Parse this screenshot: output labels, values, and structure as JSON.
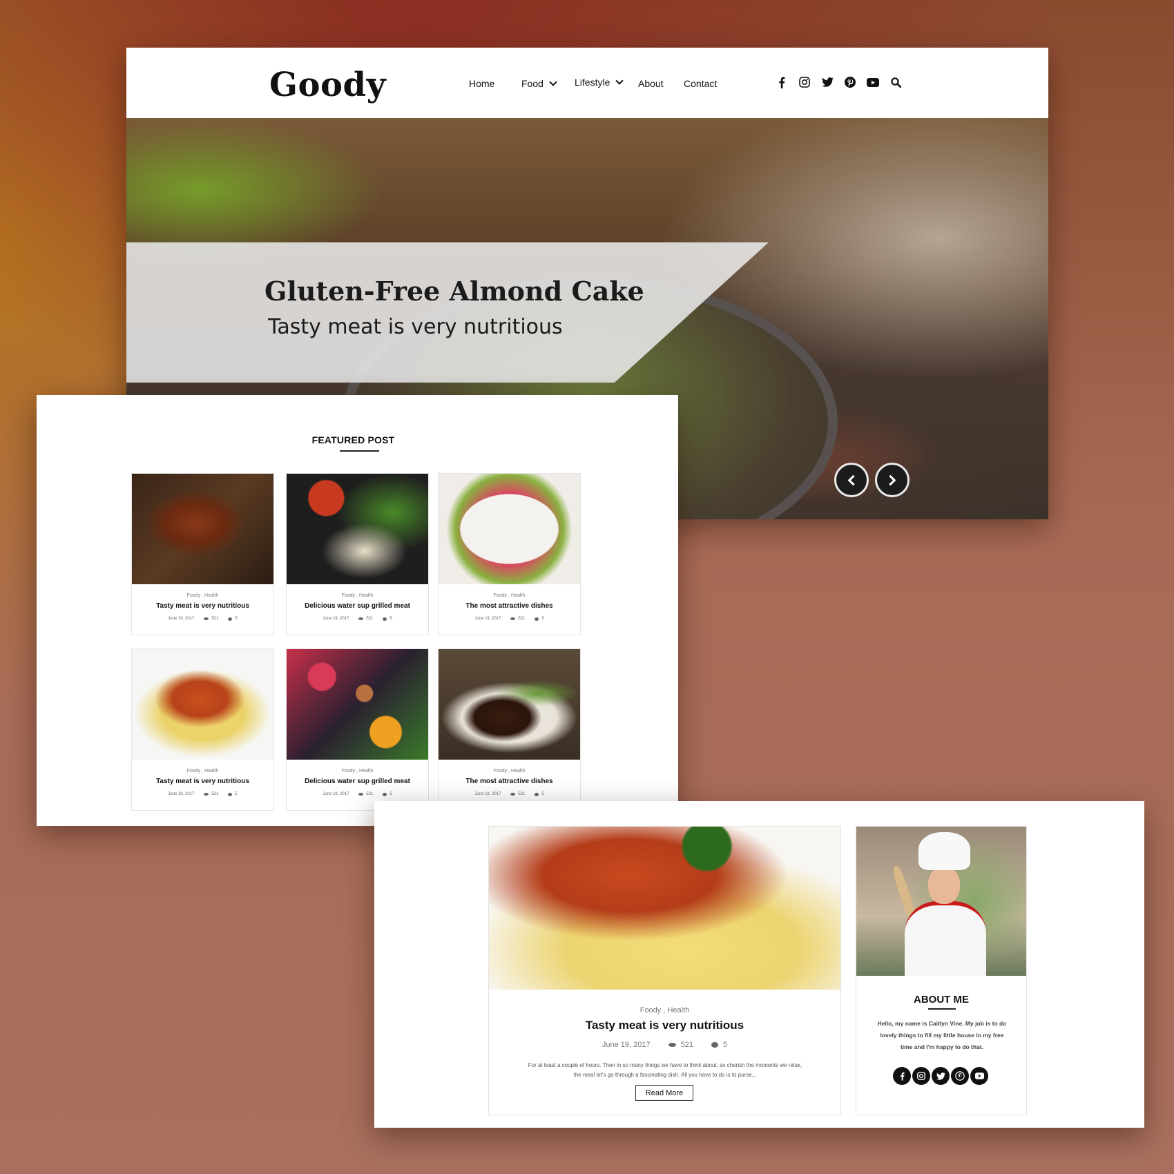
{
  "site": {
    "logo": "Goody",
    "nav": [
      {
        "label": "Home",
        "has_dropdown": false
      },
      {
        "label": "Food",
        "has_dropdown": true
      },
      {
        "label": "Lifestyle",
        "has_dropdown": true
      },
      {
        "label": "About",
        "has_dropdown": false
      },
      {
        "label": "Contact",
        "has_dropdown": false
      }
    ],
    "social_icons": [
      "facebook-icon",
      "instagram-icon",
      "twitter-icon",
      "pinterest-icon",
      "youtube-icon",
      "search-icon"
    ]
  },
  "hero": {
    "title": "Gluten-Free Almond Cake",
    "subtitle": "Tasty meat is very nutritious",
    "prev_icon": "chevron-left-icon",
    "next_icon": "chevron-right-icon"
  },
  "featured": {
    "heading": "FEATURED POST",
    "cards": [
      {
        "image": "grilled-steak-on-board",
        "categories": "Foody , Health",
        "title": "Tasty meat is very nutritious",
        "date": "June 19, 2017",
        "views": "521",
        "comments": "5"
      },
      {
        "image": "vegetables-tomato-broccoli",
        "categories": "Foody , Health",
        "title": "Delicious water sup grilled meat",
        "date": "June 19, 2017",
        "views": "521",
        "comments": "5"
      },
      {
        "image": "fruit-platter",
        "categories": "Foody , Health",
        "title": "The most attractive dishes",
        "date": "June 19, 2017",
        "views": "521",
        "comments": "5"
      },
      {
        "image": "spaghetti-bolognese",
        "categories": "Foody , Health",
        "title": "Tasty meat is very nutritious",
        "date": "June 19, 2017",
        "views": "521",
        "comments": "5"
      },
      {
        "image": "berries-nuts-mango",
        "categories": "Foody , Health",
        "title": "Delicious water sup grilled meat",
        "date": "June 19, 2017",
        "views": "521",
        "comments": "5"
      },
      {
        "image": "steak-with-asparagus",
        "categories": "Foody , Health",
        "title": "The most attractive dishes",
        "date": "June 19, 2017",
        "views": "521",
        "comments": "5"
      }
    ]
  },
  "post": {
    "image": "spaghetti-bolognese",
    "categories": "Foody , Health",
    "title": "Tasty meat is very nutritious",
    "date": "June 19, 2017",
    "views": "521",
    "comments": "5",
    "excerpt": "For at least a couple of hours. Then in so many things we have to think about, so cherish the moments we relax, the meal let's go through a fascinating dish. All you have to do is to purse...",
    "read_more": "Read More"
  },
  "about": {
    "heading": "ABOUT ME",
    "bio": "Hello, my name is Caitlyn Vine. My job is to do lovely things to fill my little house in my free time and I'm happy to do that.",
    "social_icons": [
      "facebook-icon",
      "instagram-icon",
      "twitter-icon",
      "pinterest-icon",
      "youtube-icon"
    ]
  }
}
